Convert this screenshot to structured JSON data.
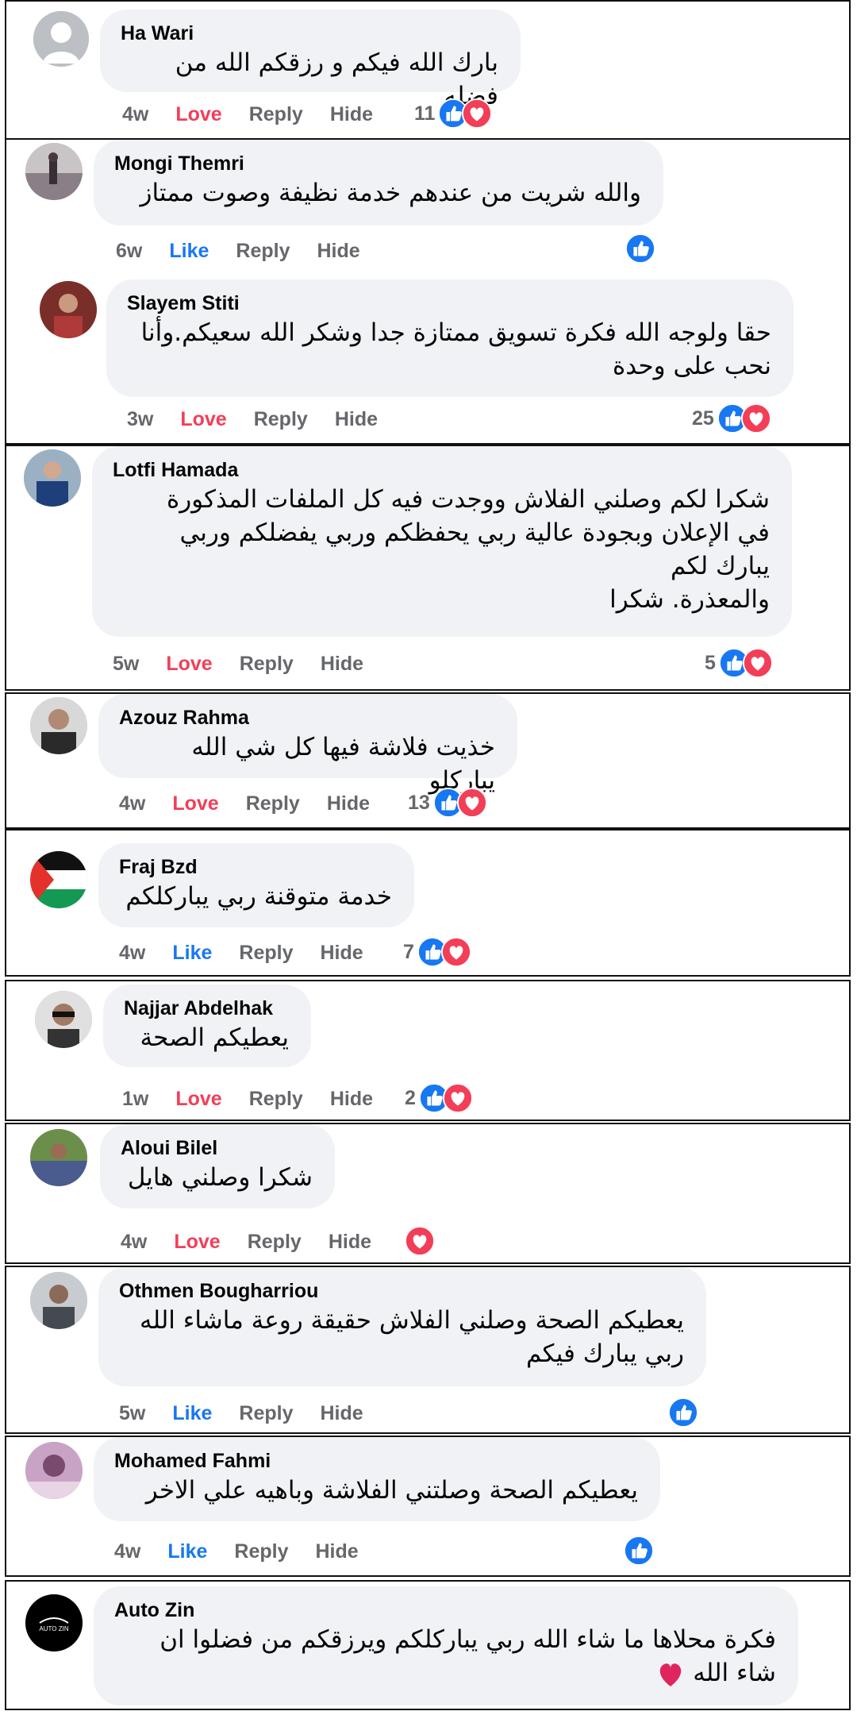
{
  "comments": [
    {
      "name": "Ha Wari",
      "text": [
        "بارك الله فيكم و رزقكم الله من فضله"
      ],
      "time": "4w",
      "reaction_label": "Love",
      "reply": "Reply",
      "hide": "Hide",
      "count": "11"
    },
    {
      "name": "Mongi Themri",
      "text": [
        "والله شريت من عندهم خدمة نظيفة وصوت ممتاز"
      ],
      "time": "6w",
      "reaction_label": "Like",
      "reply": "Reply",
      "hide": "Hide",
      "count": ""
    },
    {
      "name": "Slayem Stiti",
      "text": [
        "حقا ولوجه الله فكرة تسويق ممتازة جدا وشكر الله سعيكم.وأنا",
        "نحب على وحدة"
      ],
      "time": "3w",
      "reaction_label": "Love",
      "reply": "Reply",
      "hide": "Hide",
      "count": "25"
    },
    {
      "name": "Lotfi Hamada",
      "text": [
        "شكرا لكم وصلني الفلاش ووجدت فيه كل الملفات المذكورة",
        "في الإعلان وبجودة عالية ربي يحفظكم وربي يفضلكم وربي",
        "يبارك لكم",
        "والمعذرة. شكرا"
      ],
      "time": "5w",
      "reaction_label": "Love",
      "reply": "Reply",
      "hide": "Hide",
      "count": "5"
    },
    {
      "name": "Azouz Rahma",
      "text": [
        "خذيت فلاشة فيها كل شي الله يباركلو"
      ],
      "time": "4w",
      "reaction_label": "Love",
      "reply": "Reply",
      "hide": "Hide",
      "count": "13"
    },
    {
      "name": "Fraj Bzd",
      "text": [
        "خدمة متوقنة ربي يباركلكم"
      ],
      "time": "4w",
      "reaction_label": "Like",
      "reply": "Reply",
      "hide": "Hide",
      "count": "7"
    },
    {
      "name": "Najjar Abdelhak",
      "text": [
        "يعطيكم الصحة"
      ],
      "time": "1w",
      "reaction_label": "Love",
      "reply": "Reply",
      "hide": "Hide",
      "count": "2"
    },
    {
      "name": "Aloui Bilel",
      "text": [
        "شكرا وصلني هايل"
      ],
      "time": "4w",
      "reaction_label": "Love",
      "reply": "Reply",
      "hide": "Hide",
      "count": ""
    },
    {
      "name": "Othmen Bougharriou",
      "text": [
        "يعطيكم الصحة وصلني الفلاش حقيقة روعة ماشاء الله",
        "ربي يبارك فيكم"
      ],
      "time": "5w",
      "reaction_label": "Like",
      "reply": "Reply",
      "hide": "Hide",
      "count": ""
    },
    {
      "name": "Mohamed Fahmi",
      "text": [
        "يعطيكم الصحة وصلتني الفلاشة وباهيه علي الاخر"
      ],
      "time": "4w",
      "reaction_label": "Like",
      "reply": "Reply",
      "hide": "Hide",
      "count": ""
    },
    {
      "name": "Auto Zin",
      "text": [
        "فكرة محلاها ما شاء الله ربي يباركلكم ويرزقكم من فضلوا ان",
        "شاء الله"
      ],
      "time": "",
      "reaction_label": "",
      "reply": "",
      "hide": "",
      "count": "",
      "avatar_text": "AUTO ZIN"
    }
  ],
  "colors": {
    "like_blue": "#1877f2",
    "love_red": "#f33e58",
    "bubble_bg": "#f0f2f5",
    "muted": "#65676b"
  }
}
